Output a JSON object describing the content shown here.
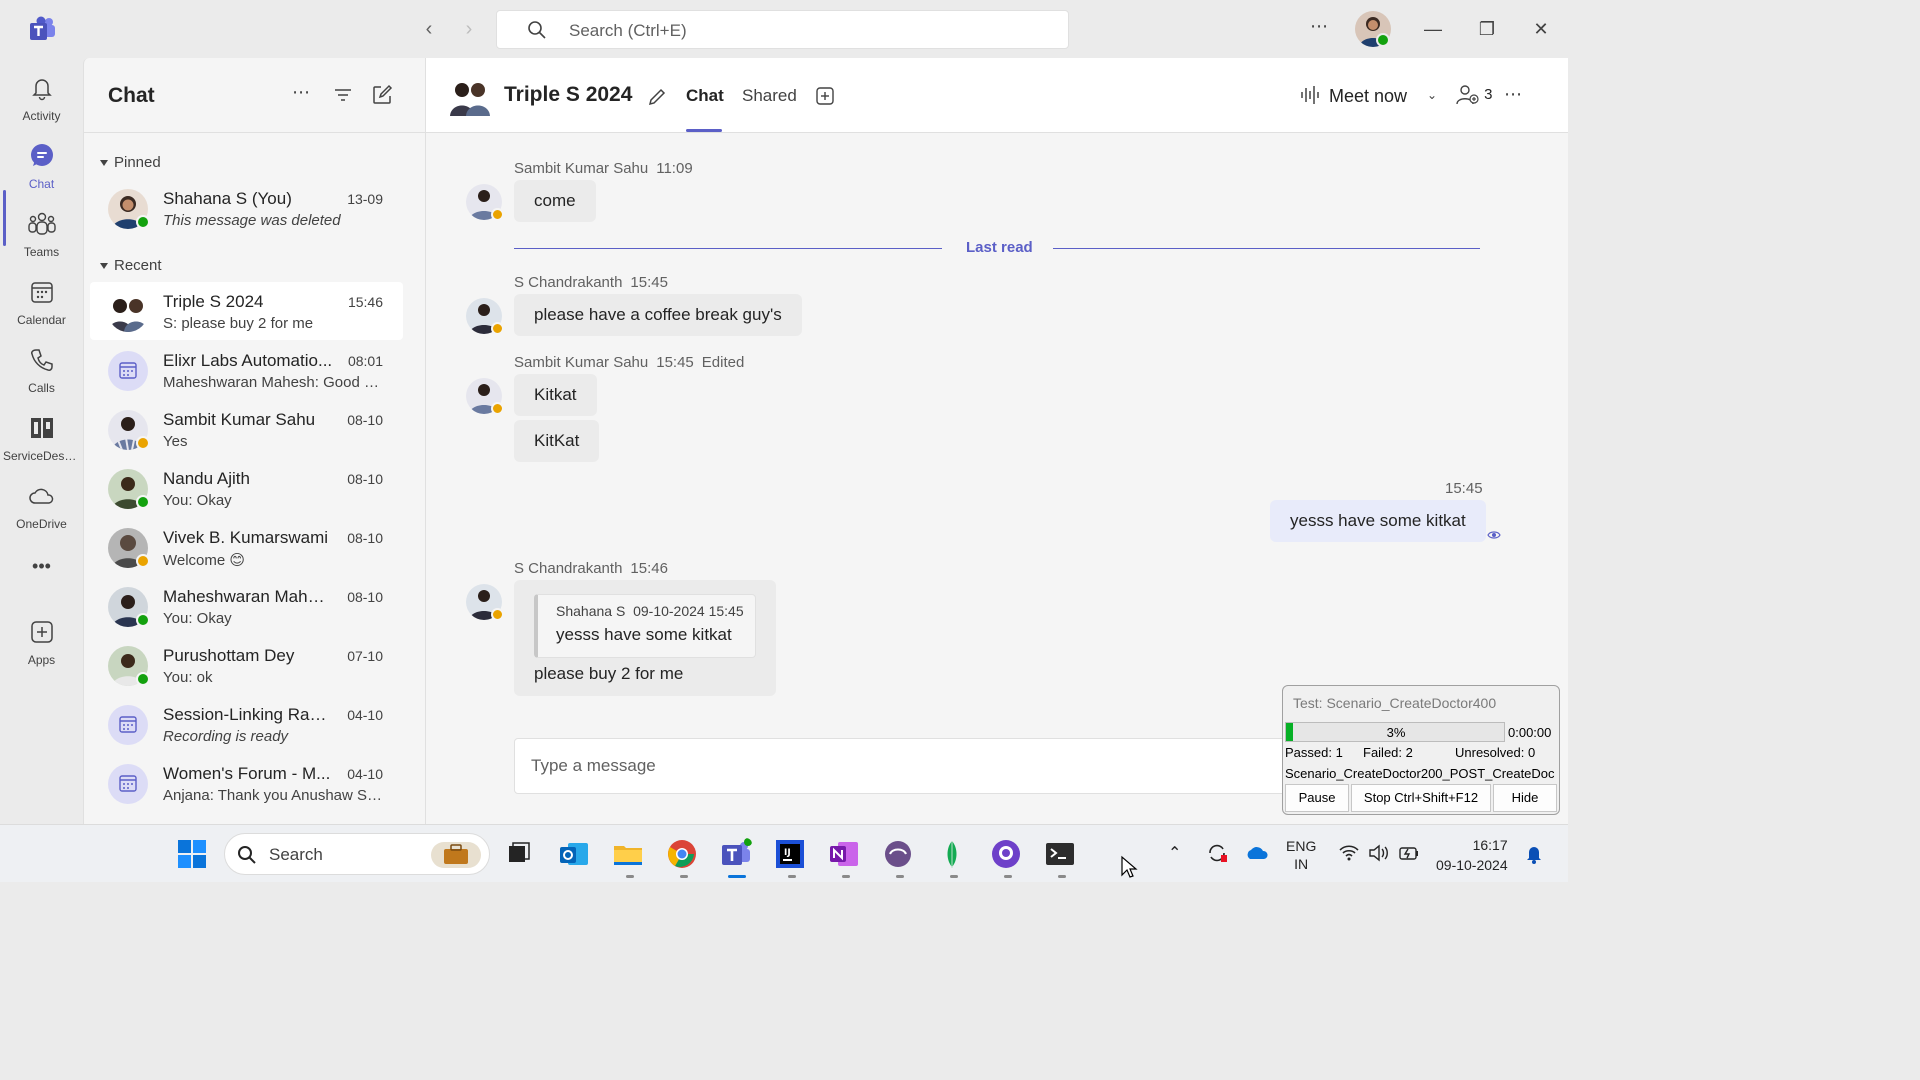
{
  "titlebar": {
    "search_placeholder": "Search (Ctrl+E)",
    "more": "⋯"
  },
  "rail": {
    "items": [
      {
        "label": "Activity",
        "icon": "bell-icon"
      },
      {
        "label": "Chat",
        "icon": "chat-icon",
        "active": true
      },
      {
        "label": "Teams",
        "icon": "teams-icon"
      },
      {
        "label": "Calendar",
        "icon": "calendar-icon"
      },
      {
        "label": "Calls",
        "icon": "phone-icon"
      },
      {
        "label": "ServiceDesk...",
        "icon": "servicedesk-icon"
      },
      {
        "label": "OneDrive",
        "icon": "cloud-icon"
      },
      {
        "label": "Apps",
        "icon": "add-apps-icon"
      }
    ],
    "more": "•••"
  },
  "chatlist": {
    "title": "Chat",
    "pinned_label": "Pinned",
    "recent_label": "Recent",
    "pinned": [
      {
        "name": "Shahana S (You)",
        "preview": "This message was deleted",
        "time": "13-09",
        "status": "available"
      }
    ],
    "recent": [
      {
        "name": "Triple S 2024",
        "preview": "S: please buy 2 for me",
        "time": "15:46",
        "type": "group"
      },
      {
        "name": "Elixr Labs Automatio...",
        "preview": "Maheshwaran Mahesh: Good M...",
        "time": "08:01",
        "type": "meeting"
      },
      {
        "name": "Sambit Kumar Sahu",
        "preview": "Yes",
        "time": "08-10",
        "status": "away"
      },
      {
        "name": "Nandu Ajith",
        "preview": "You: Okay",
        "time": "08-10",
        "status": "available"
      },
      {
        "name": "Vivek B. Kumarswami",
        "preview": "Welcome 😊",
        "time": "08-10",
        "status": "away"
      },
      {
        "name": "Maheshwaran Mahesh",
        "preview": "You: Okay",
        "time": "08-10",
        "status": "available"
      },
      {
        "name": "Purushottam Dey",
        "preview": "You: ok",
        "time": "07-10",
        "status": "available"
      },
      {
        "name": "Session-Linking Rapi...",
        "preview": "Recording is ready",
        "time": "04-10",
        "type": "meeting"
      },
      {
        "name": "Women's Forum - M...",
        "preview": "Anjana: Thank you Anushaw Sri...",
        "time": "04-10",
        "type": "meeting"
      }
    ]
  },
  "conversation": {
    "title": "Triple S 2024",
    "tabs": [
      "Chat",
      "Shared"
    ],
    "meet_now": "Meet now",
    "participants_count": "3",
    "last_read": "Last read",
    "messages": [
      {
        "sender": "Sambit Kumar Sahu",
        "time": "11:09",
        "text": "come"
      },
      {
        "sender": "S Chandrakanth",
        "time": "15:45",
        "text": "please have a coffee break guy's"
      },
      {
        "sender": "Sambit Kumar Sahu",
        "time": "15:45",
        "edited": "Edited",
        "texts": [
          "Kitkat",
          "KitKat"
        ]
      },
      {
        "sender": "me",
        "time": "15:45",
        "text": "yesss have some kitkat"
      },
      {
        "sender": "S Chandrakanth",
        "time": "15:46",
        "quote_author": "Shahana S",
        "quote_time": "09-10-2024 15:45",
        "quote_text": "yesss have some kitkat",
        "text": "please buy 2 for me"
      }
    ],
    "compose_placeholder": "Type a message"
  },
  "runner": {
    "title": "Test: Scenario_CreateDoctor400",
    "progress_pct": 3,
    "progress_label": "3%",
    "timer": "0:00:00",
    "passed": "Passed: 1",
    "failed": "Failed: 2",
    "unresolved": "Unresolved: 0",
    "scenario": "Scenario_CreateDoctor200_POST_CreateDoc",
    "btn_pause": "Pause",
    "btn_stop": "Stop Ctrl+Shift+F12",
    "btn_hide": "Hide"
  },
  "taskbar": {
    "search_label": "Search",
    "lang_top": "ENG",
    "lang_bottom": "IN",
    "time": "16:17",
    "date": "09-10-2024"
  },
  "colors": {
    "accent": "#5b5fc7",
    "available": "#13a10e",
    "away": "#eaa300"
  }
}
